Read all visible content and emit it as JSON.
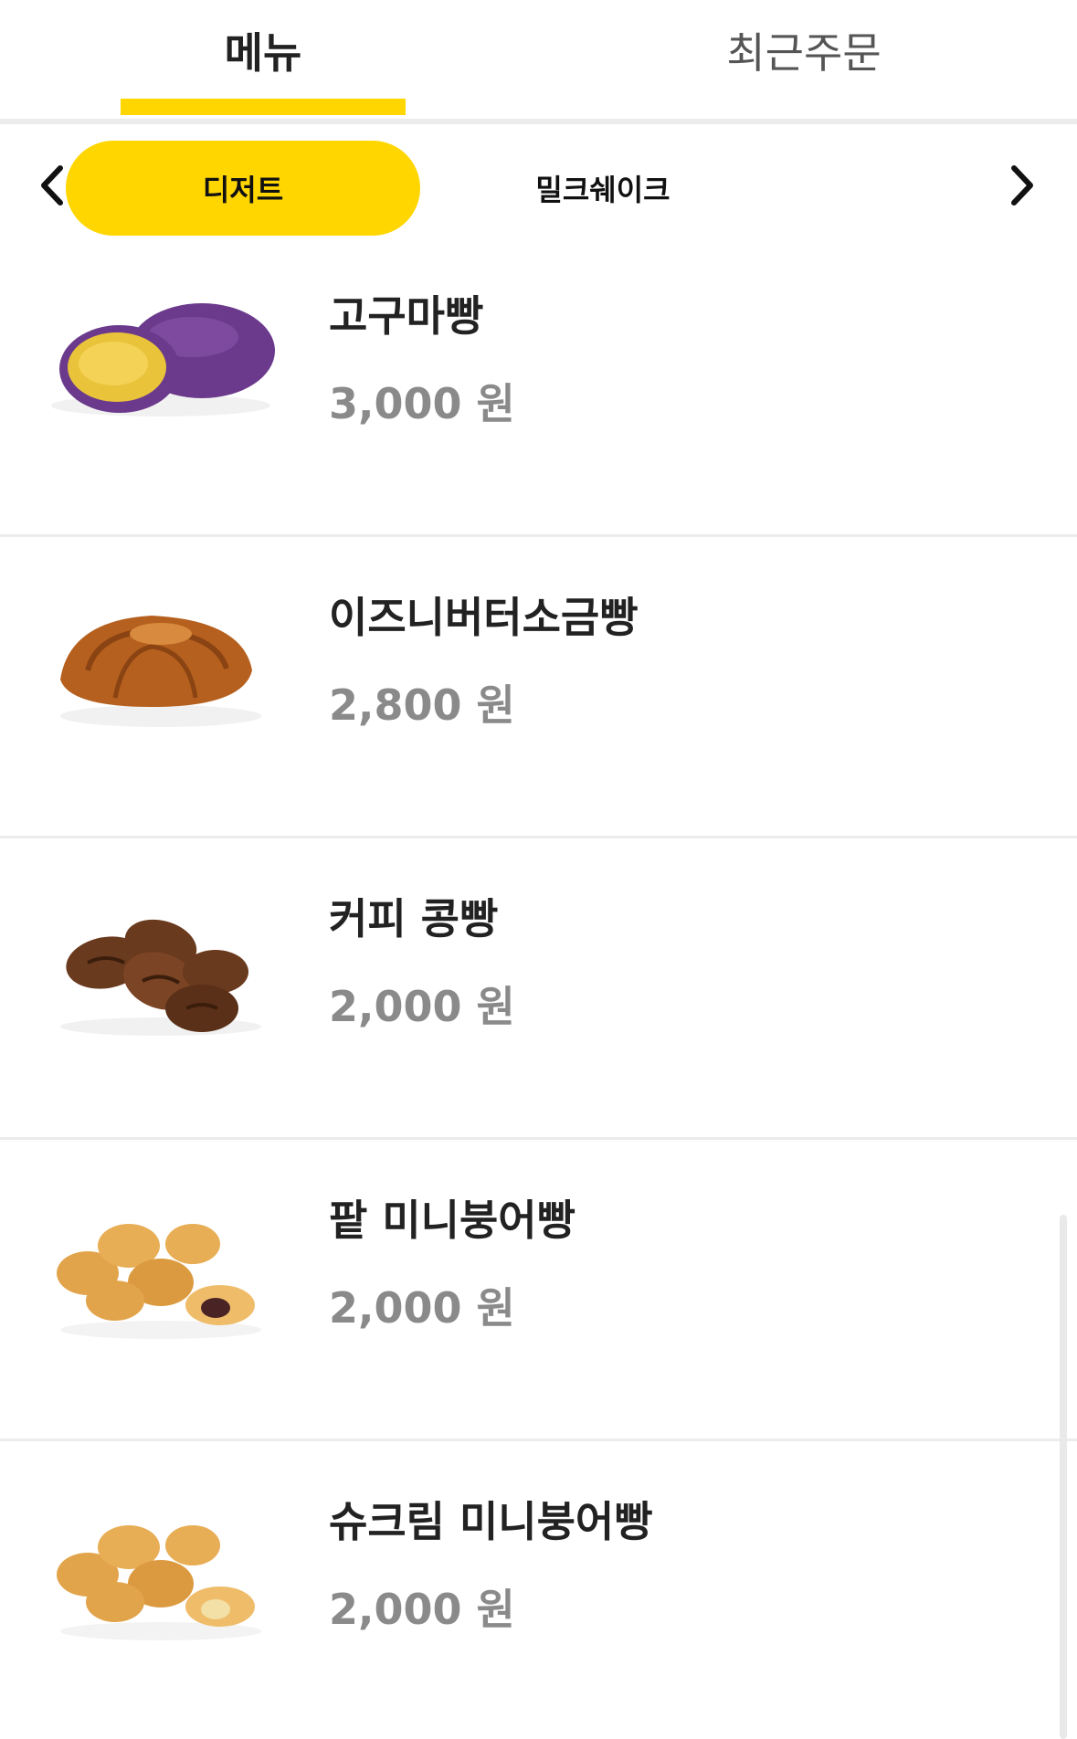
{
  "tabs": {
    "menu": "메뉴",
    "recent": "최근주문"
  },
  "categories": {
    "active": "디저트",
    "next": "밀크쉐이크"
  },
  "colors": {
    "accent": "#FFD600",
    "price": "#8a8a8a"
  },
  "items": [
    {
      "name": "고구마빵",
      "price": "3,000 원",
      "image": "sweet-potato-bread-image"
    },
    {
      "name": "이즈니버터소금빵",
      "price": "2,800 원",
      "image": "salt-butter-roll-image"
    },
    {
      "name": "커피 콩빵",
      "price": "2,000 원",
      "image": "coffee-bean-bread-image"
    },
    {
      "name": "팥 미니붕어빵",
      "price": "2,000 원",
      "image": "red-bean-mini-fish-bread-image"
    },
    {
      "name": "슈크림 미니붕어빵",
      "price": "2,000 원",
      "image": "custard-mini-fish-bread-image"
    }
  ]
}
